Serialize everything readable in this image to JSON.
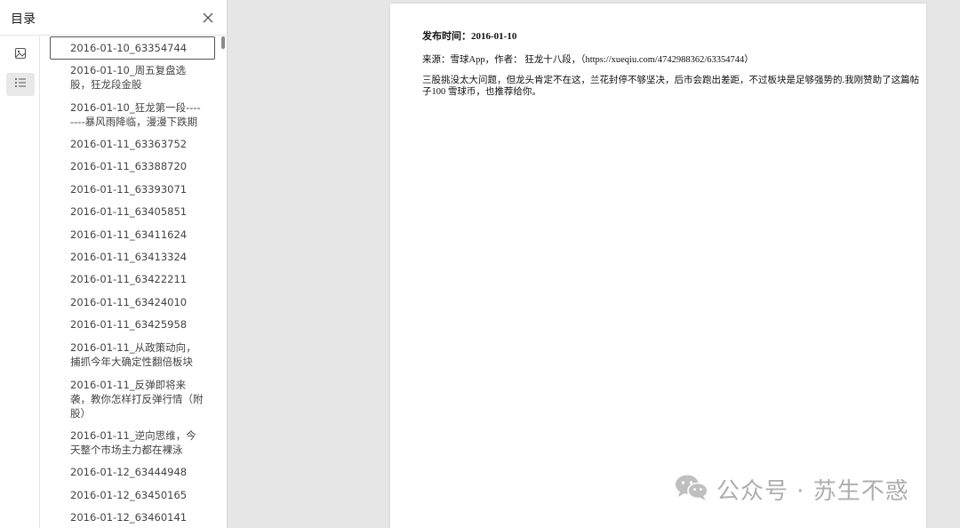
{
  "sidebar": {
    "title": "目录",
    "toc_items": [
      "2016-01-10_63354744",
      "2016-01-10_周五复盘选股，狂龙段金股",
      "2016-01-10_狂龙第一段--------暴风雨降临，漫漫下跌期",
      "2016-01-11_63363752",
      "2016-01-11_63388720",
      "2016-01-11_63393071",
      "2016-01-11_63405851",
      "2016-01-11_63411624",
      "2016-01-11_63413324",
      "2016-01-11_63422211",
      "2016-01-11_63424010",
      "2016-01-11_63425958",
      "2016-01-11_从政策动向，捕抓今年大确定性翻倍板块",
      "2016-01-11_反弹即将来袭，教你怎样打反弹行情（附股）",
      "2016-01-11_逆向思维，今天整个市场主力都在裸泳",
      "2016-01-12_63444948",
      "2016-01-12_63450165",
      "2016-01-12_63460141"
    ]
  },
  "document": {
    "date_line": "发布时间：2016-01-10",
    "source_line": "来源：雪球App，作者： 狂龙十八段，（https://xueqiu.com/4742988362/63354744）",
    "body": "三股挑没太大问题，但龙头肯定不在这，兰花封停不够坚决，后市会跑出差距，不过板块是足够强势的.我刚赞助了这篇帖子100 雪球币，也推荐给你。"
  },
  "watermark": {
    "text": "公众号 · 苏生不惑"
  }
}
